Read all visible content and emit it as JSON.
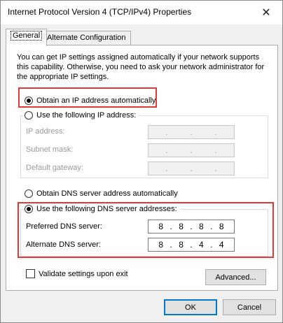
{
  "window": {
    "title": "Internet Protocol Version 4 (TCP/IPv4) Properties"
  },
  "tabs": [
    {
      "label": "General"
    },
    {
      "label": "Alternate Configuration"
    }
  ],
  "general": {
    "description": "You can get IP settings assigned automatically if your network supports this capability. Otherwise, you need to ask your network administrator for the appropriate IP settings.",
    "ip_auto_label": "Obtain an IP address automatically",
    "ip_manual_label": "Use the following IP address:",
    "ip_address_label": "IP address:",
    "subnet_mask_label": "Subnet mask:",
    "default_gateway_label": "Default gateway:",
    "dns_auto_label": "Obtain DNS server address automatically",
    "dns_manual_label": "Use the following DNS server addresses:",
    "preferred_dns_label": "Preferred DNS server:",
    "alternate_dns_label": "Alternate DNS server:",
    "preferred_dns": [
      "8",
      "8",
      "8",
      "8"
    ],
    "alternate_dns": [
      "8",
      "8",
      "4",
      "4"
    ],
    "validate_label": "Validate settings upon exit",
    "advanced_label": "Advanced..."
  },
  "footer": {
    "ok_label": "OK",
    "cancel_label": "Cancel"
  },
  "state": {
    "ip_mode": "automatic",
    "dns_mode": "manual",
    "validate_checked": false
  },
  "colors": {
    "highlight_border": "#e53935",
    "default_button_border": "#0078d7"
  }
}
